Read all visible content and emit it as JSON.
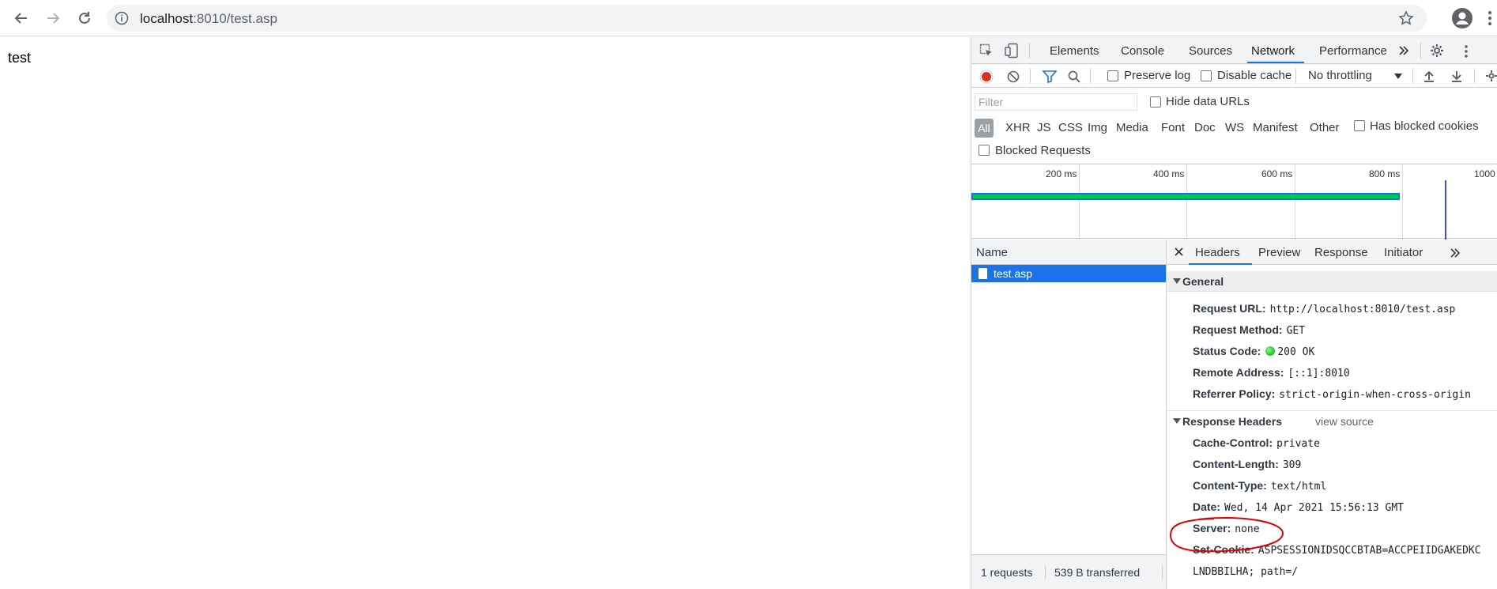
{
  "browser": {
    "url_host": "localhost",
    "url_rest": ":8010/test.asp"
  },
  "page": {
    "text": "test"
  },
  "devtools": {
    "tabs": [
      "Elements",
      "Console",
      "Sources",
      "Network",
      "Performance"
    ],
    "active_tab": "Network",
    "toolbar": {
      "preserve_log": "Preserve log",
      "disable_cache": "Disable cache",
      "throttling": "No throttling"
    },
    "filter_placeholder": "Filter",
    "hide_data_urls": "Hide data URLs",
    "types": [
      "All",
      "XHR",
      "JS",
      "CSS",
      "Img",
      "Media",
      "Font",
      "Doc",
      "WS",
      "Manifest",
      "Other"
    ],
    "has_blocked_cookies": "Has blocked cookies",
    "blocked_requests": "Blocked Requests",
    "timeline_ticks": [
      "200 ms",
      "400 ms",
      "600 ms",
      "800 ms",
      "1000"
    ],
    "list": {
      "column_name": "Name",
      "requests": [
        "test.asp"
      ],
      "requests_count": "1 requests",
      "transferred": "539 B transferred"
    },
    "detail": {
      "tabs": [
        "Headers",
        "Preview",
        "Response",
        "Initiator"
      ],
      "active_tab": "Headers",
      "general_title": "General",
      "general": [
        {
          "key": "Request URL:",
          "value": "http://localhost:8010/test.asp"
        },
        {
          "key": "Request Method:",
          "value": "GET"
        },
        {
          "key": "Status Code:",
          "value": "200 OK"
        },
        {
          "key": "Remote Address:",
          "value": "[::1]:8010"
        },
        {
          "key": "Referrer Policy:",
          "value": "strict-origin-when-cross-origin"
        }
      ],
      "response_title": "Response Headers",
      "view_source": "view source",
      "response": [
        {
          "key": "Cache-Control:",
          "value": "private"
        },
        {
          "key": "Content-Length:",
          "value": "309"
        },
        {
          "key": "Content-Type:",
          "value": "text/html"
        },
        {
          "key": "Date:",
          "value": "Wed, 14 Apr 2021 15:56:13 GMT"
        },
        {
          "key": "Server:",
          "value": "none"
        },
        {
          "key": "Set-Cookie:",
          "value": "ASPSESSIONIDSQCCBTAB=ACCPEIIDGAKEDKC"
        },
        {
          "key": "",
          "value": "LNDBBILHA; path=/"
        }
      ]
    }
  },
  "colors": {
    "accent": "#1a73e8",
    "record": "#d93025",
    "bar_green": "#00c853",
    "annotation": "#e00000"
  }
}
